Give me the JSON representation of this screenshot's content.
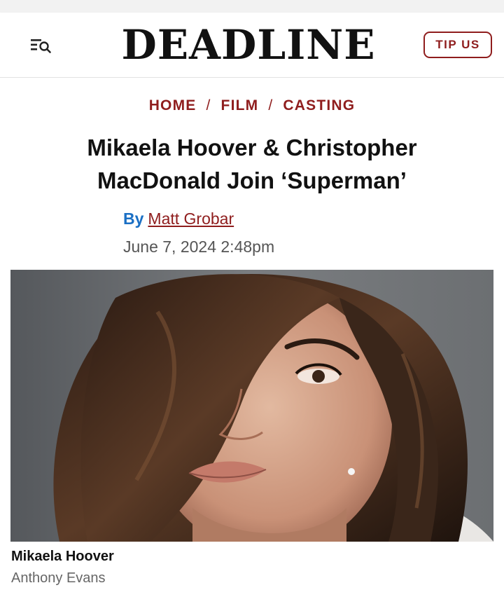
{
  "header": {
    "logo": "DEADLINE",
    "tip_label": "TIP US"
  },
  "breadcrumb": {
    "items": [
      "HOME",
      "FILM",
      "CASTING"
    ],
    "separator": "/"
  },
  "article": {
    "title_line1": "Mikaela Hoover & Christopher",
    "title_line2": "MacDonald Join ‘Superman’",
    "by_label": "By",
    "author": "Matt Grobar",
    "date": "June 7, 2024 2:48pm"
  },
  "photo": {
    "caption": "Mikaela Hoover",
    "credit": "Anthony Evans"
  },
  "colors": {
    "accent": "#8f1d1d",
    "by_blue": "#1a6fc4",
    "text": "#111111",
    "muted": "#555555"
  },
  "icons": {
    "menu": "menu-search-icon"
  }
}
